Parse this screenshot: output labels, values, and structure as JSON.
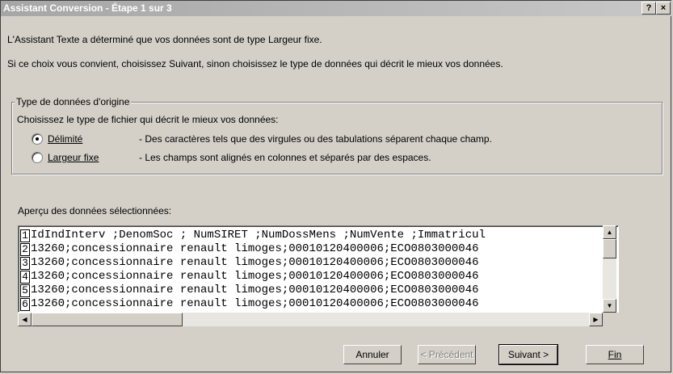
{
  "window": {
    "title": "Assistant Conversion - Étape 1 sur 3",
    "help_btn": "?",
    "close_btn": "×"
  },
  "intro": {
    "line1": "L'Assistant Texte a déterminé que vos données sont de type Largeur fixe.",
    "line2": "Si ce choix vous convient, choisissez Suivant, sinon choisissez le type de données qui décrit le mieux vos données."
  },
  "group": {
    "legend": "Type de données d'origine",
    "prompt": "Choisissez le type de fichier qui décrit le mieux vos données:",
    "options": [
      {
        "label": "Délimité",
        "desc": "- Des caractères tels que des virgules ou des tabulations séparent chaque champ.",
        "selected": true
      },
      {
        "label": "Largeur fixe",
        "desc": "- Les champs sont alignés en colonnes et séparés par des espaces.",
        "selected": false
      }
    ]
  },
  "preview": {
    "label": "Aperçu des données sélectionnées:",
    "rows": [
      {
        "num": "1",
        "text": "IdIndInterv ;DenomSoc ; NumSIRET ;NumDossMens ;NumVente ;Immatricul"
      },
      {
        "num": "2",
        "text": "13260;concessionnaire renault limoges;00010120400006;ECO0803000046"
      },
      {
        "num": "3",
        "text": "13260;concessionnaire renault limoges;00010120400006;ECO0803000046"
      },
      {
        "num": "4",
        "text": "13260;concessionnaire renault limoges;00010120400006;ECO0803000046"
      },
      {
        "num": "5",
        "text": "13260;concessionnaire renault limoges;00010120400006;ECO0803000046"
      },
      {
        "num": "6",
        "text": "13260;concessionnaire renault limoges;00010120400006;ECO0803000046"
      }
    ]
  },
  "buttons": {
    "cancel": "Annuler",
    "previous": "< Précédent",
    "next": "Suivant >",
    "finish": "Fin"
  },
  "icons": {
    "scroll_up": "up-arrow-icon",
    "scroll_down": "down-arrow-icon",
    "scroll_left": "left-arrow-icon",
    "scroll_right": "right-arrow-icon"
  }
}
